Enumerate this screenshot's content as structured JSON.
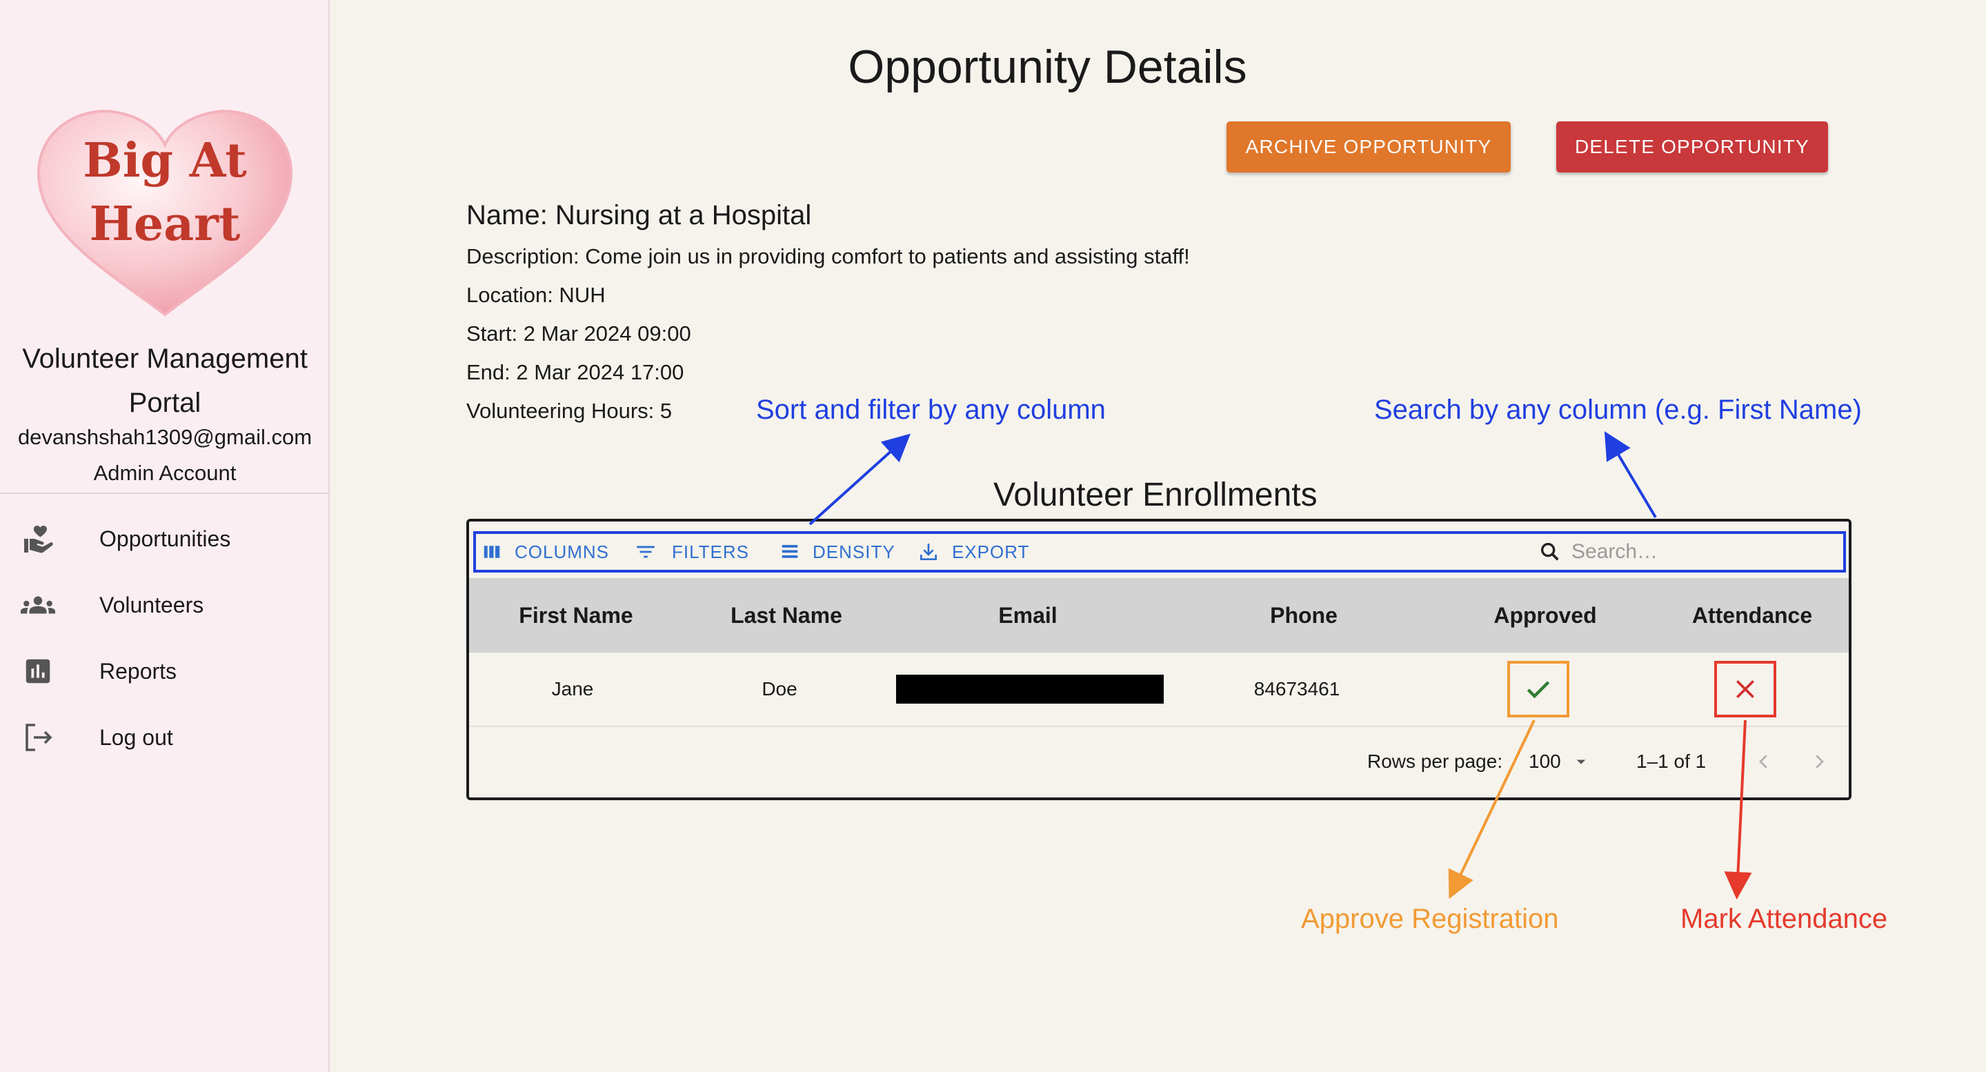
{
  "sidebar": {
    "logo_line1": "Big At",
    "logo_line2": "Heart",
    "portal_title_line1": "Volunteer Management",
    "portal_title_line2": "Portal",
    "email": "devanshshah1309@gmail.com",
    "role": "Admin Account",
    "nav": [
      {
        "label": "Opportunities",
        "icon": "volunteer-hand-heart-icon"
      },
      {
        "label": "Volunteers",
        "icon": "people-icon"
      },
      {
        "label": "Reports",
        "icon": "bar-chart-icon"
      },
      {
        "label": "Log out",
        "icon": "logout-icon"
      }
    ]
  },
  "page": {
    "title": "Opportunity Details",
    "archive_label": "ARCHIVE OPPORTUNITY",
    "delete_label": "DELETE OPPORTUNITY"
  },
  "details": {
    "name": "Name: Nursing at a Hospital",
    "description": "Description: Come join us in providing comfort to patients and assisting staff!",
    "location": "Location: NUH",
    "start": "Start: 2 Mar 2024 09:00",
    "end": "End: 2 Mar 2024 17:00",
    "hours": "Volunteering Hours: 5"
  },
  "annotations": {
    "sort_filter": "Sort and filter by any column",
    "search": "Search by any column (e.g. First Name)",
    "approve": "Approve Registration",
    "attendance": "Mark Attendance"
  },
  "enrollments": {
    "title": "Volunteer Enrollments",
    "toolbar": {
      "columns": "COLUMNS",
      "filters": "FILTERS",
      "density": "DENSITY",
      "export": "EXPORT",
      "search_placeholder": "Search…"
    },
    "columns": [
      "First Name",
      "Last Name",
      "Email",
      "Phone",
      "Approved",
      "Attendance"
    ],
    "rows": [
      {
        "first_name": "Jane",
        "last_name": "Doe",
        "email": "",
        "phone": "84673461",
        "approved": true,
        "attendance": false
      }
    ],
    "footer": {
      "rows_per_page_label": "Rows per page:",
      "rows_per_page_value": "100",
      "range": "1–1 of 1"
    }
  },
  "colors": {
    "sidebar_bg": "#fbeef3",
    "page_bg": "#f5f3ec",
    "archive": "#e0772b",
    "delete": "#c9383a",
    "link_blue": "#2f6fd1",
    "annot_blue": "#1f3fe0",
    "annot_orange": "#f29a34",
    "annot_red": "#e53a2c",
    "approved_green": "#2e7d32"
  }
}
